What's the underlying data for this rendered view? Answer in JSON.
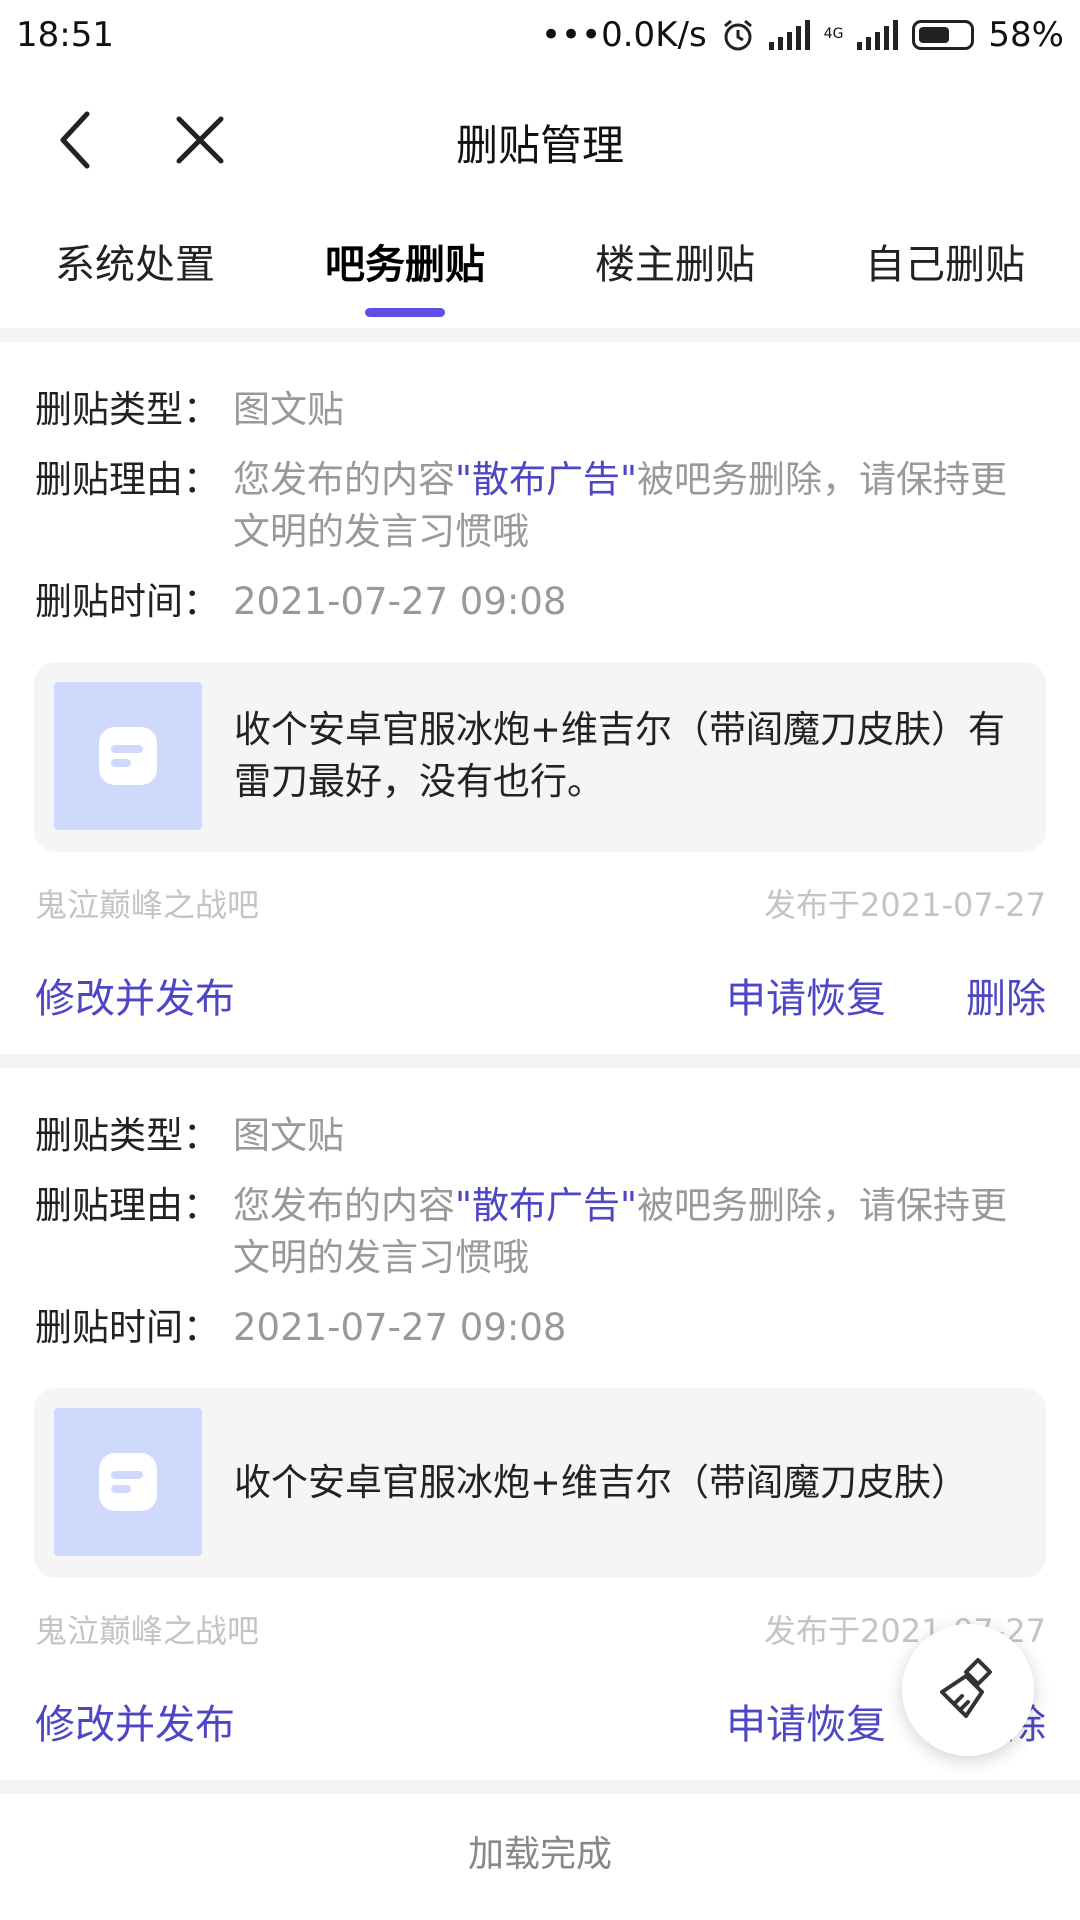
{
  "status_bar": {
    "time": "18:51",
    "net_speed": "•••0.0K/s",
    "network_type": "4G",
    "battery": "58%"
  },
  "nav": {
    "title": "删贴管理",
    "back_icon": "chevron-left-icon",
    "close_icon": "close-icon"
  },
  "tabs": [
    {
      "label": "系统处置",
      "active": false
    },
    {
      "label": "吧务删贴",
      "active": true
    },
    {
      "label": "楼主删贴",
      "active": false
    },
    {
      "label": "自己删贴",
      "active": false
    }
  ],
  "labels": {
    "type": "删贴类型：",
    "reason": "删贴理由：",
    "time": "删贴时间："
  },
  "records": [
    {
      "type": "图文贴",
      "reason_prefix": "您发布的内容",
      "reason_highlight": "\"散布广告\"",
      "reason_suffix": "被吧务删除，请保持更文明的发言习惯哦",
      "time": "2021-07-27 09:08",
      "post_text": "收个安卓官服冰炮+维吉尔（带阎魔刀皮肤）有雷刀最好，没有也行。",
      "forum": "鬼泣巅峰之战吧",
      "published": "发布于2021-07-27",
      "action_edit": "修改并发布",
      "action_restore": "申请恢复",
      "action_delete": "删除"
    },
    {
      "type": "图文贴",
      "reason_prefix": "您发布的内容",
      "reason_highlight": "\"散布广告\"",
      "reason_suffix": "被吧务删除，请保持更文明的发言习惯哦",
      "time": "2021-07-27 09:08",
      "post_text": "收个安卓官服冰炮+维吉尔（带阎魔刀皮肤）",
      "forum": "鬼泣巅峰之战吧",
      "published": "发布于2021-07-27",
      "action_edit": "修改并发布",
      "action_restore": "申请恢复",
      "action_delete": "删除"
    }
  ],
  "footer": "加载完成",
  "fab_icon": "broom-icon",
  "colors": {
    "accent": "#4f46c5",
    "indicator": "#5f4ee6",
    "muted": "#999999"
  }
}
